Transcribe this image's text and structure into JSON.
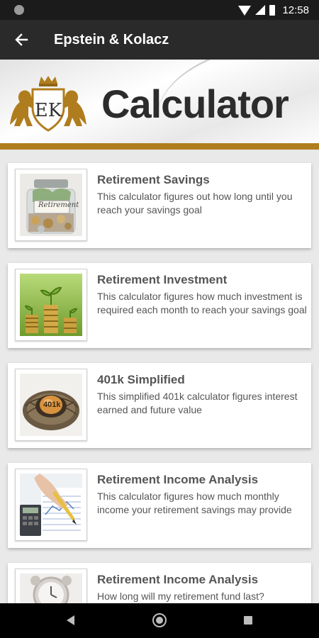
{
  "status_bar": {
    "time": "12:58"
  },
  "app_bar": {
    "title": "Epstein & Kolacz"
  },
  "banner": {
    "logo_text": "EK",
    "title": "Calculator"
  },
  "calculators": [
    {
      "title": "Retirement Savings",
      "description": "This calculator figures out how long until you reach your savings goal",
      "thumb_label": "Retirement",
      "icon": "jar-of-coins-icon"
    },
    {
      "title": "Retirement Investment",
      "description": "This calculator figures how much investment is required each month to reach your savings goal",
      "icon": "coin-stacks-plants-icon"
    },
    {
      "title": "401k Simplified",
      "description": "This simplified 401k calculator figures interest earned and future value",
      "thumb_label": "401k",
      "icon": "nest-egg-icon"
    },
    {
      "title": "Retirement Income Analysis",
      "description": "This calculator figures how much monthly income your retirement savings may provide",
      "icon": "calculator-writing-icon"
    },
    {
      "title": "Retirement Income Analysis",
      "description": "How long will my retirement fund last?",
      "icon": "clock-icon"
    }
  ],
  "colors": {
    "accent_gold": "#b07d1e",
    "app_bar": "#2a2a2a",
    "status_bar": "#1b1b1b"
  }
}
